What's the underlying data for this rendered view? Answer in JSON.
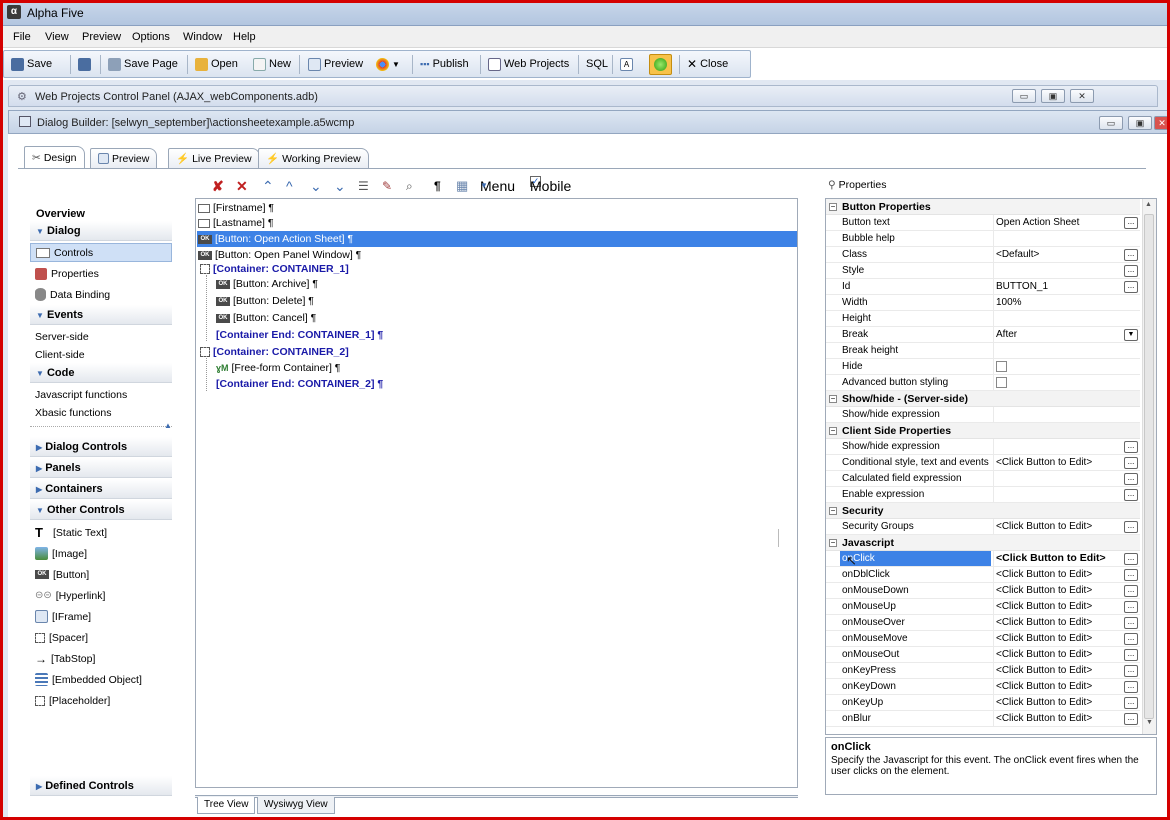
{
  "window": {
    "title": "Alpha Five",
    "app_icon": "α"
  },
  "menu": {
    "items": [
      "File",
      "View",
      "Preview",
      "Options",
      "Window",
      "Help"
    ]
  },
  "toolbar": {
    "save": "Save",
    "save_page": "Save Page",
    "open": "Open",
    "new": "New",
    "preview": "Preview",
    "publish": "Publish",
    "web_projects": "Web Projects",
    "sql": "SQL",
    "close": "Close"
  },
  "web_projects_window": {
    "title": "Web Projects Control Panel (AJAX_webComponents.adb)"
  },
  "dialog_builder": {
    "title": "Dialog Builder: [selwyn_september]\\actionsheetexample.a5wcmp"
  },
  "tabs": [
    "Design",
    "Preview",
    "Live Preview",
    "Working Preview"
  ],
  "left_nav": {
    "overview": "Overview",
    "dialog": "Dialog",
    "controls": "Controls",
    "properties": "Properties",
    "data_binding": "Data Binding",
    "events": "Events",
    "server_side": "Server-side",
    "client_side": "Client-side",
    "code": "Code",
    "javascript_functions": "Javascript functions",
    "xbasic_functions": "Xbasic functions",
    "dialog_controls": "Dialog Controls",
    "panels": "Panels",
    "containers": "Containers",
    "other_controls": "Other Controls",
    "other_items": [
      "[Static Text]",
      "[Image]",
      "[Button]",
      "[Hyperlink]",
      "[IFrame]",
      "[Spacer]",
      "[TabStop]",
      "[Embedded Object]",
      "[Placeholder]"
    ],
    "defined_controls": "Defined Controls"
  },
  "tree_toolbar": {
    "menu": "Menu",
    "mobile": "Mobile",
    "mobile_checked": true
  },
  "tree": [
    "[Firstname] ¶",
    "[Lastname] ¶",
    "[Button: Open Action Sheet] ¶",
    "[Button: Open Panel Window] ¶",
    "[Container: CONTAINER_1]",
    "[Button: Archive] ¶",
    "[Button: Delete] ¶",
    "[Button: Cancel] ¶",
    "[Container End: CONTAINER_1] ¶",
    "[Container: CONTAINER_2]",
    "[Free-form Container] ¶",
    "[Container End: CONTAINER_2] ¶"
  ],
  "bottom_tabs": [
    "Tree View",
    "Wysiwyg View"
  ],
  "properties": {
    "header": "Properties",
    "cat_button": "Button Properties",
    "button_text": {
      "k": "Button text",
      "v": "Open Action Sheet"
    },
    "bubble_help": "Bubble help",
    "class": {
      "k": "Class",
      "v": "<Default>"
    },
    "style": "Style",
    "id": {
      "k": "Id",
      "v": "BUTTON_1"
    },
    "width": {
      "k": "Width",
      "v": "100%"
    },
    "height": "Height",
    "break": {
      "k": "Break",
      "v": "After"
    },
    "break_height": "Break height",
    "hide": "Hide",
    "advanced": "Advanced button styling",
    "cat_showhide": "Show/hide - (Server-side)",
    "showhide_expr": "Show/hide expression",
    "cat_client": "Client Side Properties",
    "client_showhide": "Show/hide expression",
    "cond_style": {
      "k": "Conditional style, text and events",
      "v": "<Click Button to Edit>"
    },
    "calc_field": "Calculated field expression",
    "enable_expr": "Enable expression",
    "cat_security": "Security",
    "security_groups": {
      "k": "Security Groups",
      "v": "<Click Button to Edit>"
    },
    "cat_js": "Javascript",
    "js_events": [
      {
        "k": "onClick",
        "v": "<Click Button to Edit>"
      },
      {
        "k": "onDblClick",
        "v": "<Click Button to Edit>"
      },
      {
        "k": "onMouseDown",
        "v": "<Click Button to Edit>"
      },
      {
        "k": "onMouseUp",
        "v": "<Click Button to Edit>"
      },
      {
        "k": "onMouseOver",
        "v": "<Click Button to Edit>"
      },
      {
        "k": "onMouseMove",
        "v": "<Click Button to Edit>"
      },
      {
        "k": "onMouseOut",
        "v": "<Click Button to Edit>"
      },
      {
        "k": "onKeyPress",
        "v": "<Click Button to Edit>"
      },
      {
        "k": "onKeyDown",
        "v": "<Click Button to Edit>"
      },
      {
        "k": "onKeyUp",
        "v": "<Click Button to Edit>"
      },
      {
        "k": "onBlur",
        "v": "<Click Button to Edit>"
      }
    ]
  },
  "help": {
    "title": "onClick",
    "text": "Specify the Javascript for this event. The onClick event fires when the user clicks on the element."
  },
  "colors": {
    "accent": "#3d82e6",
    "frame": "#d40000",
    "container_text": "#1a1aa8"
  }
}
